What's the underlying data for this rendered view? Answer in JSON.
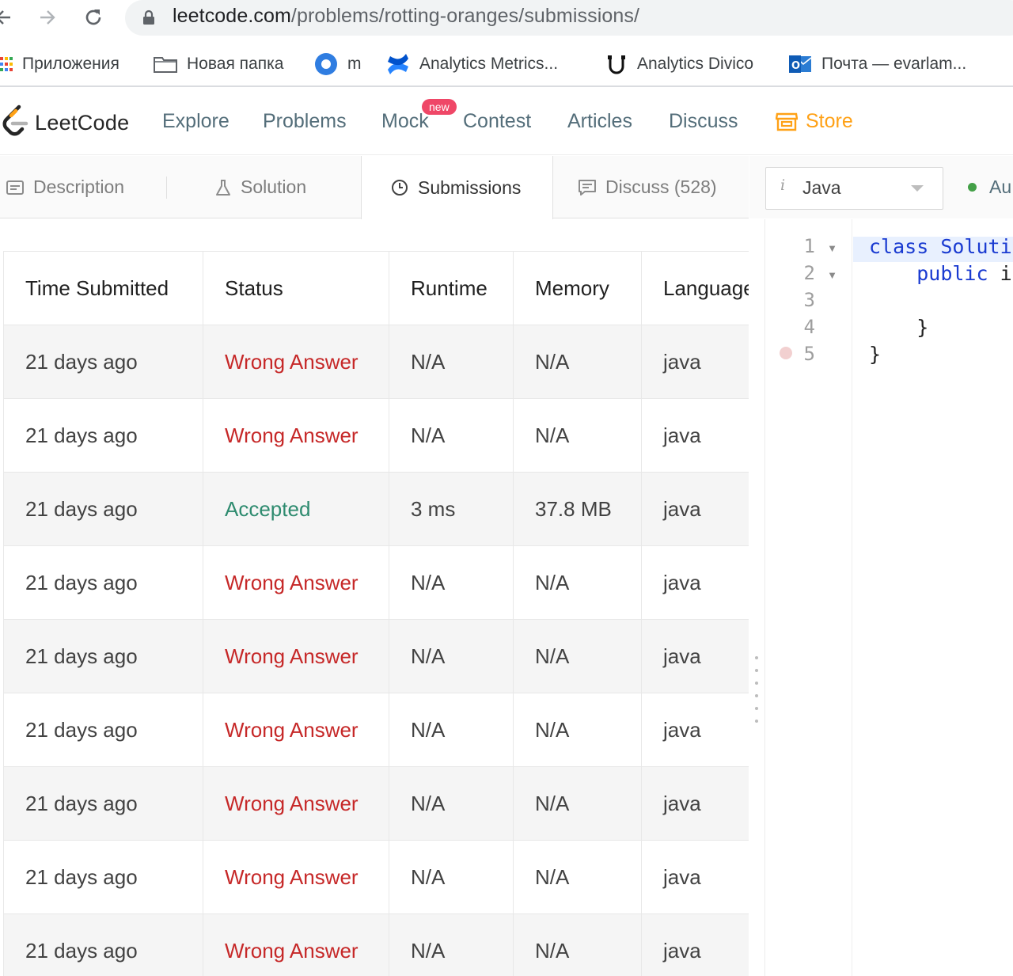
{
  "browser": {
    "url_host": "leetcode.com",
    "url_path": "/problems/rotting-oranges/submissions/",
    "bookmarks": [
      {
        "label": "Приложения",
        "icon": "apps-grid-icon"
      },
      {
        "label": "Новая папка",
        "icon": "folder-icon"
      },
      {
        "label": "m",
        "icon": "circle-o-icon"
      },
      {
        "label": "Analytics Metrics...",
        "icon": "confluence-icon"
      },
      {
        "label": "Analytics Divico",
        "icon": "divico-icon"
      },
      {
        "label": "Почта — evarlam...",
        "icon": "outlook-icon"
      }
    ]
  },
  "leetcode": {
    "logo_text": "LeetCode",
    "nav": [
      "Explore",
      "Problems",
      "Mock",
      "Contest",
      "Articles",
      "Discuss",
      "Store"
    ],
    "new_badge": "new",
    "brand_color": "#ffa116"
  },
  "tabs": [
    {
      "label": "Description",
      "icon": "description-icon"
    },
    {
      "label": "Solution",
      "icon": "flask-icon"
    },
    {
      "label": "Submissions",
      "icon": "clock-icon",
      "active": true
    },
    {
      "label": "Discuss (528)",
      "icon": "discuss-icon"
    }
  ],
  "editor": {
    "language": "Java",
    "lang_hint": "i",
    "autocomplete_label": "Au",
    "line_numbers": [
      "1",
      "2",
      "3",
      "4",
      "5"
    ],
    "code_lines": {
      "l1_kw": "class",
      "l1_rest": " Soluti",
      "l2_kw": "public",
      "l2_rest": " i",
      "l4": "}",
      "l5": "}"
    }
  },
  "submissions": {
    "columns": [
      "Time Submitted",
      "Status",
      "Runtime",
      "Memory",
      "Language"
    ],
    "rows": [
      {
        "time": "21 days ago",
        "status": "Wrong Answer",
        "runtime": "N/A",
        "memory": "N/A",
        "language": "java"
      },
      {
        "time": "21 days ago",
        "status": "Wrong Answer",
        "runtime": "N/A",
        "memory": "N/A",
        "language": "java"
      },
      {
        "time": "21 days ago",
        "status": "Accepted",
        "runtime": "3 ms",
        "memory": "37.8 MB",
        "language": "java"
      },
      {
        "time": "21 days ago",
        "status": "Wrong Answer",
        "runtime": "N/A",
        "memory": "N/A",
        "language": "java"
      },
      {
        "time": "21 days ago",
        "status": "Wrong Answer",
        "runtime": "N/A",
        "memory": "N/A",
        "language": "java"
      },
      {
        "time": "21 days ago",
        "status": "Wrong Answer",
        "runtime": "N/A",
        "memory": "N/A",
        "language": "java"
      },
      {
        "time": "21 days ago",
        "status": "Wrong Answer",
        "runtime": "N/A",
        "memory": "N/A",
        "language": "java"
      },
      {
        "time": "21 days ago",
        "status": "Wrong Answer",
        "runtime": "N/A",
        "memory": "N/A",
        "language": "java"
      },
      {
        "time": "21 days ago",
        "status": "Wrong Answer",
        "runtime": "N/A",
        "memory": "N/A",
        "language": "java"
      }
    ],
    "status_colors": {
      "Wrong Answer": "#c62828",
      "Accepted": "#2e8b6f"
    }
  }
}
